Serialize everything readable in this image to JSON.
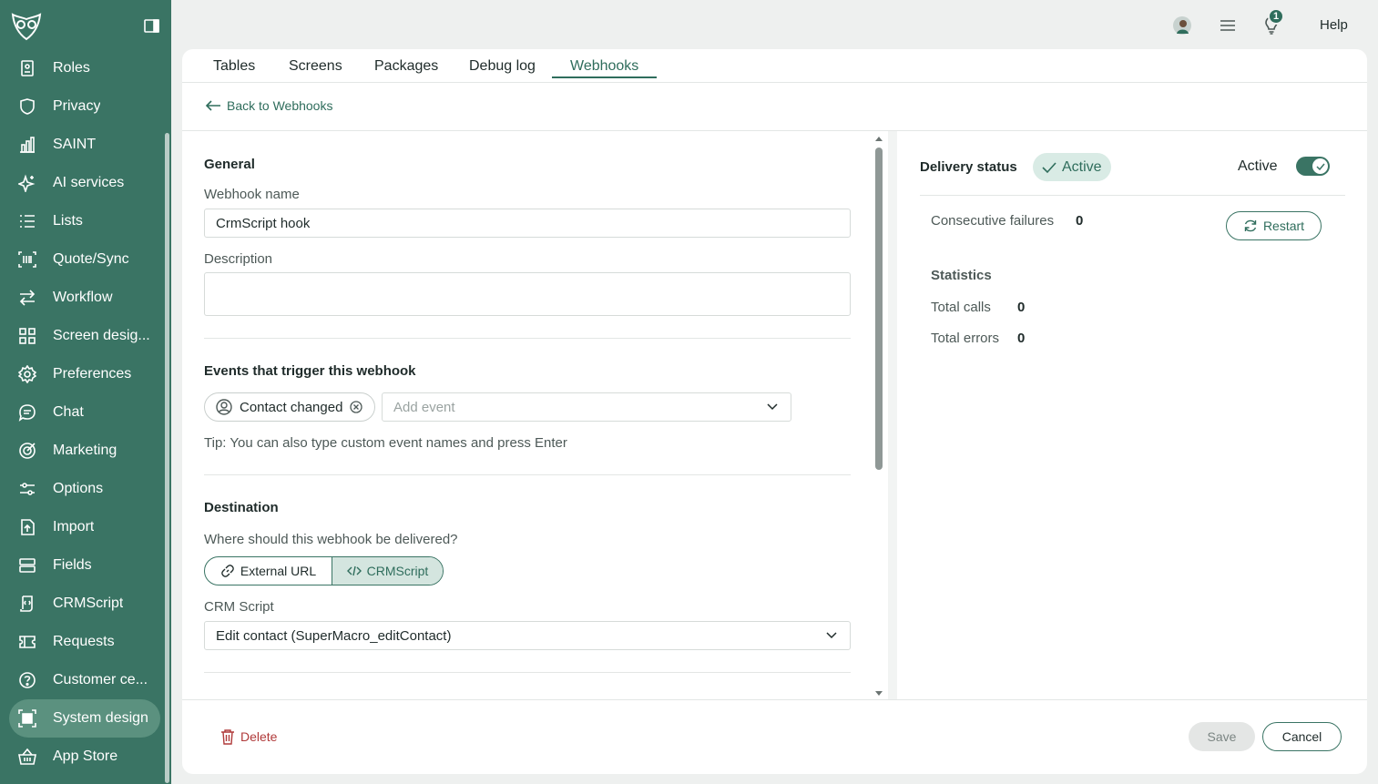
{
  "sidebar": {
    "items": [
      {
        "label": "Roles",
        "icon": "roles-icon"
      },
      {
        "label": "Privacy",
        "icon": "shield-icon"
      },
      {
        "label": "SAINT",
        "icon": "bar-chart-icon"
      },
      {
        "label": "AI services",
        "icon": "sparkle-icon"
      },
      {
        "label": "Lists",
        "icon": "list-icon"
      },
      {
        "label": "Quote/Sync",
        "icon": "barcode-icon"
      },
      {
        "label": "Workflow",
        "icon": "arrows-icon"
      },
      {
        "label": "Screen desig...",
        "icon": "grid-icon"
      },
      {
        "label": "Preferences",
        "icon": "gear-icon"
      },
      {
        "label": "Chat",
        "icon": "chat-icon"
      },
      {
        "label": "Marketing",
        "icon": "target-icon"
      },
      {
        "label": "Options",
        "icon": "sliders-icon"
      },
      {
        "label": "Import",
        "icon": "import-icon"
      },
      {
        "label": "Fields",
        "icon": "fields-icon"
      },
      {
        "label": "CRMScript",
        "icon": "script-icon"
      },
      {
        "label": "Requests",
        "icon": "ticket-icon"
      },
      {
        "label": "Customer ce...",
        "icon": "help-circle-icon"
      },
      {
        "label": "System design",
        "icon": "system-design-icon",
        "active": true
      },
      {
        "label": "App Store",
        "icon": "basket-icon"
      }
    ]
  },
  "topbar": {
    "help_label": "Help",
    "notification_count": "1"
  },
  "tabs": [
    {
      "label": "Tables"
    },
    {
      "label": "Screens"
    },
    {
      "label": "Packages"
    },
    {
      "label": "Debug log"
    },
    {
      "label": "Webhooks",
      "active": true
    }
  ],
  "back_label": "Back to Webhooks",
  "general": {
    "heading": "General",
    "name_label": "Webhook name",
    "name_value": "CrmScript hook",
    "description_label": "Description",
    "description_value": ""
  },
  "events": {
    "heading": "Events that trigger this webhook",
    "chip_label": "Contact changed",
    "add_placeholder": "Add event",
    "tip": "Tip: You can also type custom event names and press Enter"
  },
  "destination": {
    "heading": "Destination",
    "question": "Where should this webhook be delivered?",
    "external_url_label": "External URL",
    "crmscript_label": "CRMScript",
    "script_label": "CRM Script",
    "script_value": "Edit contact (SuperMacro_editContact)"
  },
  "status": {
    "delivery_label": "Delivery status",
    "delivery_value": "Active",
    "toggle_label": "Active",
    "toggle_on": true,
    "failures_label": "Consecutive failures",
    "failures_value": "0",
    "restart_label": "Restart",
    "statistics_heading": "Statistics",
    "total_calls_label": "Total calls",
    "total_calls_value": "0",
    "total_errors_label": "Total errors",
    "total_errors_value": "0"
  },
  "footer": {
    "delete_label": "Delete",
    "save_label": "Save",
    "cancel_label": "Cancel"
  },
  "colors": {
    "sidebar": "#3a7464",
    "accent": "#2f6d5c",
    "danger": "#b03a3a"
  }
}
